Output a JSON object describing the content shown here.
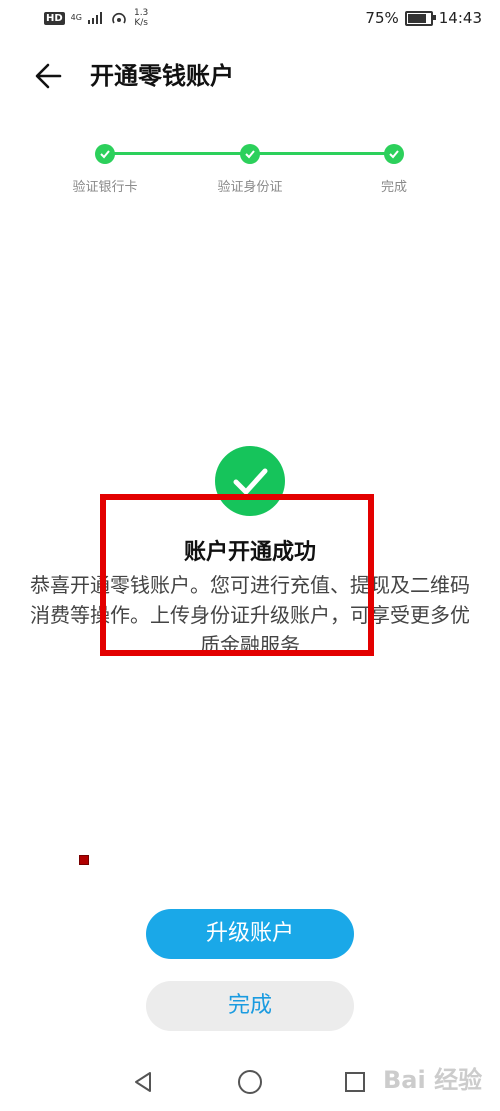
{
  "status_bar": {
    "hd": "HD",
    "network": "4G",
    "speed": "1.3\nK/s",
    "battery": "75%",
    "battery_level": 0.75,
    "time": "14:43"
  },
  "header": {
    "title": "开通零钱账户"
  },
  "steps": [
    {
      "label": "验证银行卡",
      "done": true
    },
    {
      "label": "验证身份证",
      "done": true
    },
    {
      "label": "完成",
      "done": true
    }
  ],
  "success": {
    "title": "账户开通成功",
    "description": "恭喜开通零钱账户。您可进行充值、提现及二维码消费等操作。上传身份证升级账户，可享受更多优质金融服务"
  },
  "buttons": {
    "upgrade": "升级账户",
    "done": "完成"
  },
  "colors": {
    "green": "#16c45b",
    "step_green": "#2cd05b",
    "blue": "#1aa8e8",
    "highlight_red": "#e30000"
  },
  "watermark": "Bai 经验"
}
